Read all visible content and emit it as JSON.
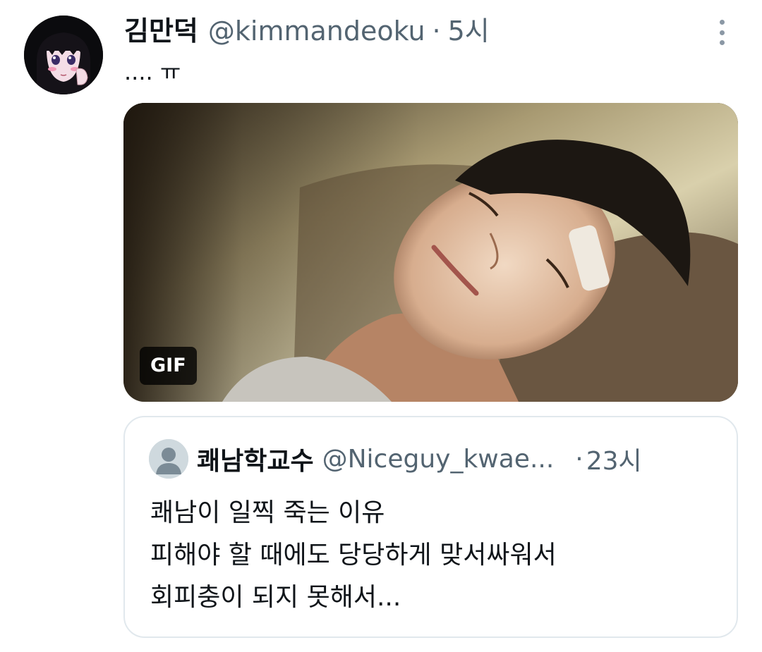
{
  "tweet": {
    "author": {
      "display_name": "김만덕",
      "handle": "@kimmandeoku",
      "avatar_icon": "anime-girl-avatar"
    },
    "separator": "·",
    "time": "5시",
    "more_icon": "vertical-ellipsis-icon",
    "text": ".... ㅠ",
    "media": {
      "type": "gif",
      "badge_label": "GIF",
      "description_icon": "sleeping-man-gif"
    },
    "quoted_tweet": {
      "author": {
        "display_name": "쾌남학교수",
        "handle": "@Niceguy_kwae...",
        "avatar_icon": "default-profile-avatar"
      },
      "separator": "·",
      "time": "23시",
      "lines": [
        "쾌남이 일찍 죽는 이유",
        "피해야 할 때에도 당당하게 맞서싸워서",
        "회피충이 되지 못해서..."
      ]
    }
  },
  "colors": {
    "text_primary": "#0f1419",
    "text_secondary": "#536471",
    "border": "#e1e8ed",
    "background": "#ffffff"
  }
}
